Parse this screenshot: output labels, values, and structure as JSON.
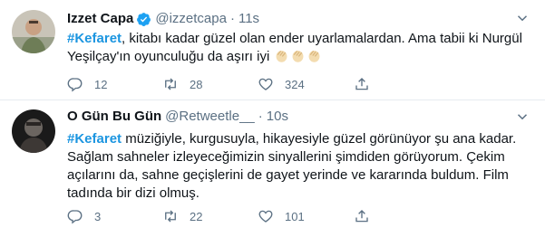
{
  "tweets": [
    {
      "name": "Izzet Capa",
      "verified": true,
      "handle": "@izzetcapa",
      "time": "11s",
      "hashtag": "#Kefaret",
      "text": ", kitabı kadar güzel olan ender uyarlamalardan. Ama tabii ki Nurgül Yeşilçay'ın oyunculuğu da aşırı iyi",
      "emoji": "clapping-hands x3",
      "replies": "12",
      "retweets": "28",
      "likes": "324"
    },
    {
      "name": "O Gün Bu Gün",
      "verified": false,
      "handle": "@Retweetle__",
      "time": "10s",
      "hashtag": "#Kefaret",
      "text": " müziğiyle, kurgusuyla, hikayesiyle güzel görünüyor şu ana kadar. Sağlam sahneler izleyeceğimizin sinyallerini şimdiden görüyorum. Çekim açılarını da, sahne geçişlerini de gayet yerinde ve kararında buldum. Film tadında bir dizi olmuş.",
      "replies": "3",
      "retweets": "22",
      "likes": "101"
    }
  ],
  "separator": "·",
  "colors": {
    "hashtag": "#1b95e0",
    "secondary_text": "#5b7083",
    "verified": "#1da1f2",
    "divider": "#e6ecf0"
  },
  "icons": [
    "verified-badge-icon",
    "chevron-down-icon",
    "reply-icon",
    "retweet-icon",
    "like-icon",
    "share-icon",
    "clapping-hands-icon"
  ]
}
